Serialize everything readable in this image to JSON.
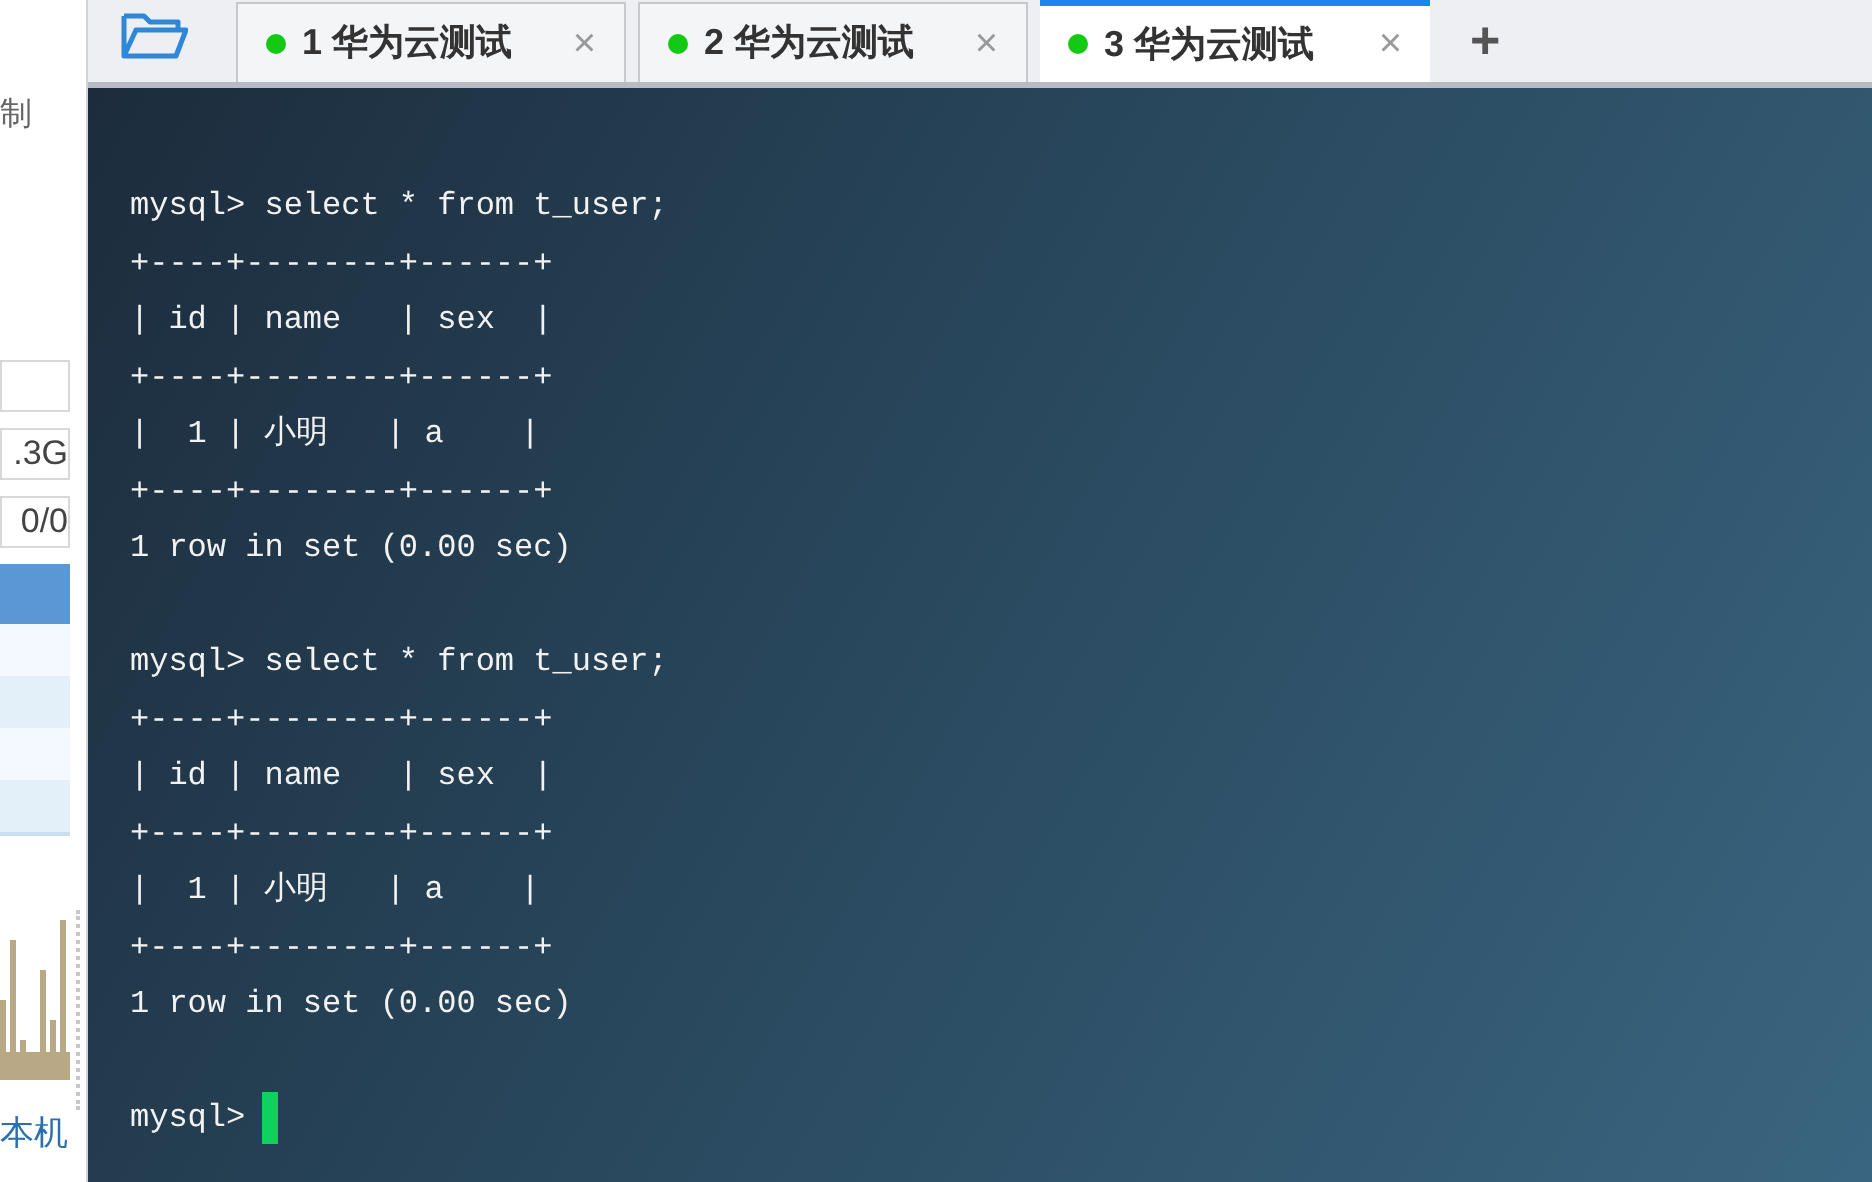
{
  "sidebar": {
    "label": "制",
    "fields": [
      {
        "value": ".3G"
      },
      {
        "value": "0/0"
      }
    ],
    "link": "本机"
  },
  "toolbar": {
    "tabs": [
      {
        "number": "1",
        "title": "华为云测试",
        "selected": false
      },
      {
        "number": "2",
        "title": "华为云测试",
        "selected": false
      },
      {
        "number": "3",
        "title": "华为云测试",
        "selected": true
      }
    ],
    "close": "×",
    "add": "+"
  },
  "terminal": {
    "blocks": [
      {
        "lines": [
          "mysql> select * from t_user;",
          "+----+--------+------+",
          "| id | name   | sex  |",
          "+----+--------+------+",
          "|  1 | 小明   | a    |",
          "+----+--------+------+",
          "1 row in set (0.00 sec)"
        ]
      },
      {
        "lines": [
          "mysql> select * from t_user;",
          "+----+--------+------+",
          "| id | name   | sex  |",
          "+----+--------+------+",
          "|  1 | 小明   | a    |",
          "+----+--------+------+",
          "1 row in set (0.00 sec)"
        ]
      }
    ],
    "prompt": "mysql>"
  }
}
